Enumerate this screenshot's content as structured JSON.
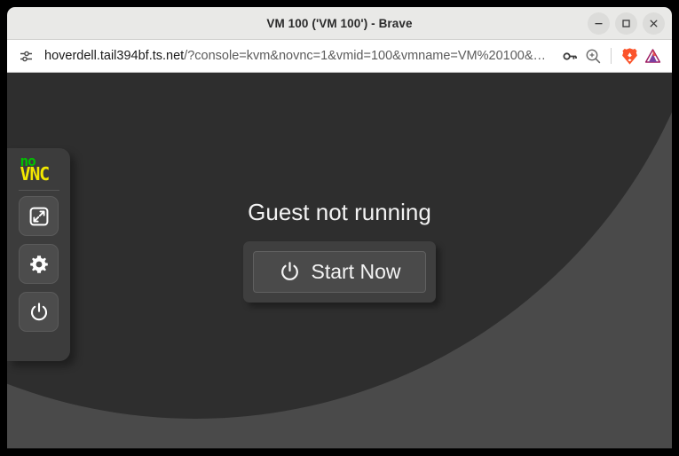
{
  "window": {
    "title": "VM 100 ('VM 100') - Brave",
    "controls": [
      {
        "name": "minimize",
        "label": "–"
      },
      {
        "name": "maximize",
        "label": "□"
      },
      {
        "name": "close",
        "label": "✕"
      }
    ]
  },
  "addressbar": {
    "site_settings_icon": "tune-sliders-icon",
    "url_domain": "hoverdell.tail394bf.ts.net",
    "url_path": "/?console=kvm&novnc=1&vmid=100&vmname=VM%20100&…",
    "url_full": "hoverdell.tail394bf.ts.net/?console=kvm&novnc=1&vmid=100&vmname=VM%20100&…",
    "icons": [
      {
        "name": "password-key-icon",
        "title": "Save password"
      },
      {
        "name": "zoom-in-icon",
        "title": "Zoom"
      },
      {
        "name": "brave-lion-icon",
        "title": "Brave Shields",
        "color": "#fb542b"
      },
      {
        "name": "bat-triangle-icon",
        "title": "Brave Rewards",
        "color": "#9e1f63"
      }
    ]
  },
  "vnc": {
    "background_outer_color": "#4a4a4a",
    "background_inner_color": "#2e2e2e",
    "sidebar": {
      "logo_top": "no",
      "logo_bottom": "VNC",
      "logo_top_color": "#00c000",
      "logo_bottom_color": "#f3e800",
      "buttons": [
        {
          "name": "fullscreen-button",
          "icon": "expand-arrows-icon",
          "title": "Fullscreen"
        },
        {
          "name": "settings-button",
          "icon": "gear-icon",
          "title": "Settings"
        },
        {
          "name": "power-button",
          "icon": "power-icon",
          "title": "Power"
        }
      ]
    },
    "guest": {
      "status_text": "Guest not running",
      "start_button_label": "Start Now",
      "start_button_icon": "power-icon"
    }
  }
}
